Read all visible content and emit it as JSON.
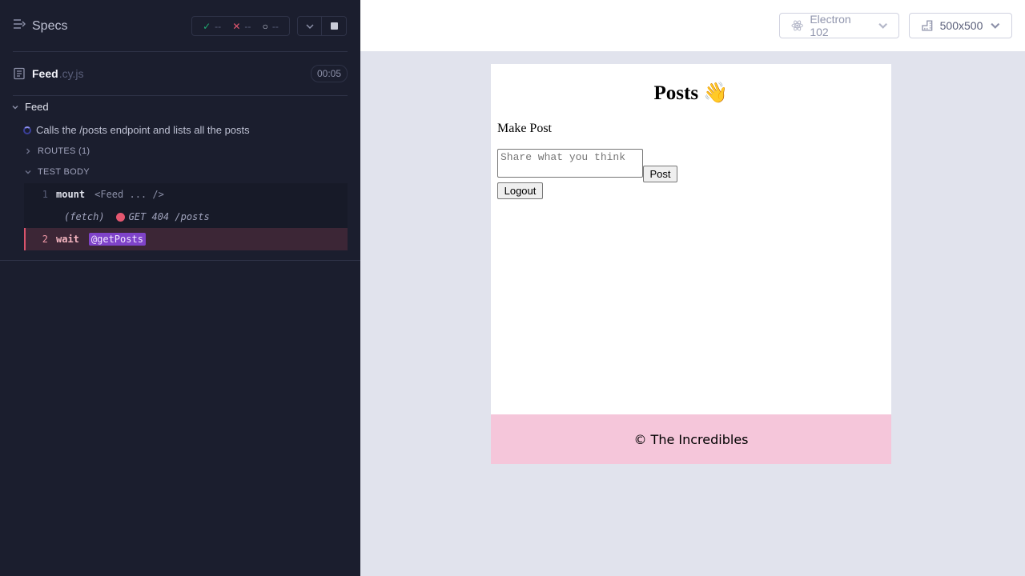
{
  "reporter": {
    "specs_label": "Specs",
    "stats": {
      "passed": "--",
      "failed": "--",
      "pending": "--"
    },
    "spec_file": {
      "name": "Feed",
      "ext": ".cy.js",
      "duration": "00:05"
    },
    "suite": {
      "title": "Feed"
    },
    "test": {
      "title": "Calls the /posts endpoint and lists all the posts"
    },
    "sections": {
      "routes": "ROUTES (1)",
      "test_body": "TEST BODY"
    },
    "commands": [
      {
        "num": "1",
        "name": "mount",
        "message": "<Feed ... />"
      },
      {
        "type": "(fetch)",
        "method": "GET",
        "status": "404",
        "url": "/posts",
        "request": "GET 404 /posts"
      },
      {
        "num": "2",
        "name": "wait",
        "alias": "@getPosts"
      }
    ],
    "colors": {
      "pass": "#1fa971",
      "fail": "#e45770",
      "alias_bg": "#7f43c9"
    }
  },
  "aut_header": {
    "browser": "Electron 102",
    "viewport": "500x500"
  },
  "app": {
    "title": "Posts 👋",
    "make_post": "Make Post",
    "textarea_placeholder": "Share what you think",
    "post_button": "Post",
    "logout_button": "Logout",
    "footer": "© The Incredibles",
    "footer_color": "#f5c6da"
  }
}
